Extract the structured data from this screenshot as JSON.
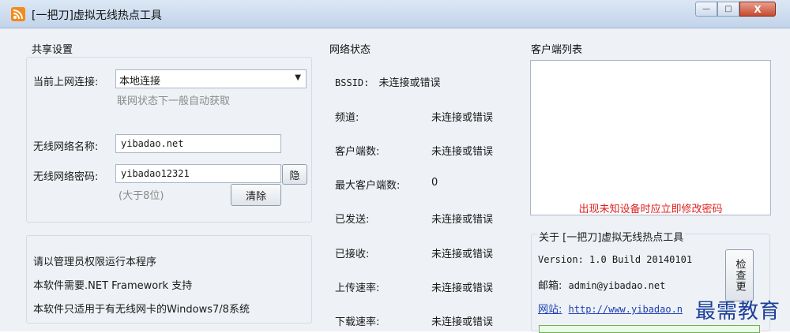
{
  "window": {
    "title": "[一把刀]虚拟无线热点工具",
    "controls": {
      "minimize": "—",
      "maximize": "□",
      "close": "X"
    }
  },
  "share_settings": {
    "section_title": "共享设置",
    "connection_label": "当前上网连接:",
    "connection_value": "本地连接",
    "connection_hint": "联网状态下一般自动获取",
    "ssid_label": "无线网络名称:",
    "ssid_value": "yibadao.net",
    "password_label": "无线网络密码:",
    "password_value": "yibadao12321",
    "hide_button": "隐",
    "password_hint": "(大于8位)",
    "clear_button": "清除"
  },
  "info_box": {
    "line1": "请以管理员权限运行本程序",
    "line2": "本软件需要.NET Framework 支持",
    "line3": "本软件只适用于有无线网卡的Windows7/8系统"
  },
  "network_status": {
    "section_title": "网络状态",
    "bssid_label": "BSSID:",
    "bssid_value": "未连接或错误",
    "rows": [
      {
        "label": "频道:",
        "value": "未连接或错误"
      },
      {
        "label": "客户端数:",
        "value": "未连接或错误"
      },
      {
        "label": "最大客户端数:",
        "value": "0"
      },
      {
        "label": "已发送:",
        "value": "未连接或错误"
      },
      {
        "label": "已接收:",
        "value": "未连接或错误"
      },
      {
        "label": "上传速率:",
        "value": "未连接或错误"
      },
      {
        "label": "下载速率:",
        "value": "未连接或错误"
      }
    ]
  },
  "clients": {
    "section_title": "客户端列表",
    "warning": "出现未知设备时应立即修改密码"
  },
  "about": {
    "title": "关于 [一把刀]虚拟无线热点工具",
    "version": "Version: 1.0  Build 20140101",
    "email_label": "邮箱:",
    "email_value": "admin@yibadao.net",
    "site_label": "网站:",
    "site_value": "http://www.yibadao.n",
    "check_update_button": "检查更"
  },
  "watermark": "最需教育",
  "colors": {
    "warning": "#e02020",
    "link": "#1d3fb5",
    "app_icon": "#f28a1c"
  }
}
